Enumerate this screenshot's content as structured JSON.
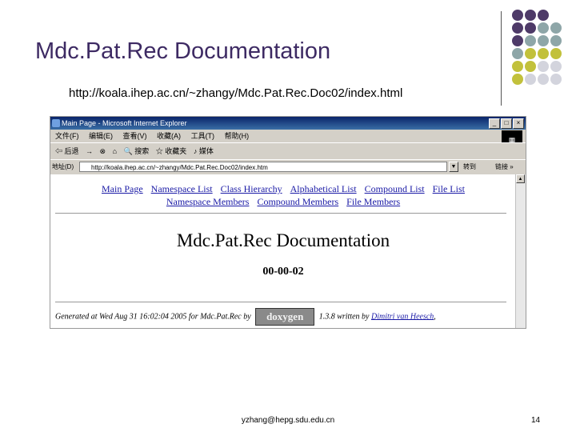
{
  "slide": {
    "title": "Mdc.Pat.Rec Documentation",
    "url": "http://koala.ihep.ac.cn/~zhangy/Mdc.Pat.Rec.Doc02/index.html",
    "footer_email": "yzhang@hepg.sdu.edu.cn",
    "page_number": "14",
    "colors": {
      "title": "#3d2a63",
      "dot_purple": "#4e3a68",
      "dot_teal": "#8ea6a8",
      "dot_yellow": "#c2c13b",
      "dot_gray": "#d3d4dd"
    }
  },
  "browser": {
    "title": "Main Page - Microsoft Internet Explorer",
    "window_buttons": [
      "_",
      "□",
      "×"
    ],
    "menu": [
      "文件(F)",
      "编辑(E)",
      "查看(V)",
      "收藏(A)",
      "工具(T)",
      "帮助(H)"
    ],
    "toolbar": [
      "⇦ 后退",
      "→",
      "⊗",
      "⌂",
      "🔍 搜索",
      "☆ 收藏夹",
      "♪ 媒体"
    ],
    "address_label": "地址(D)",
    "address_value": "http://koala.ihep.ac.cn/~zhangy/Mdc.Pat.Rec.Doc02/index.htm",
    "go_label": "转到",
    "links_label": "链接 »"
  },
  "page": {
    "nav_row1": [
      "Main Page",
      "Namespace List",
      "Class Hierarchy",
      "Alphabetical List",
      "Compound List",
      "File List"
    ],
    "nav_row2": [
      "Namespace Members",
      "Compound Members",
      "File Members"
    ],
    "doc_title": "Mdc.Pat.Rec Documentation",
    "version": "00-00-02",
    "footer_prefix": "Generated at Wed Aug 31 16:02:04 2005 for Mdc.Pat.Rec by",
    "footer_logo": "doxygen",
    "footer_mid": "1.3.8 written by",
    "footer_author": "Dimitri van Heesch",
    "footer_suffix": ","
  }
}
